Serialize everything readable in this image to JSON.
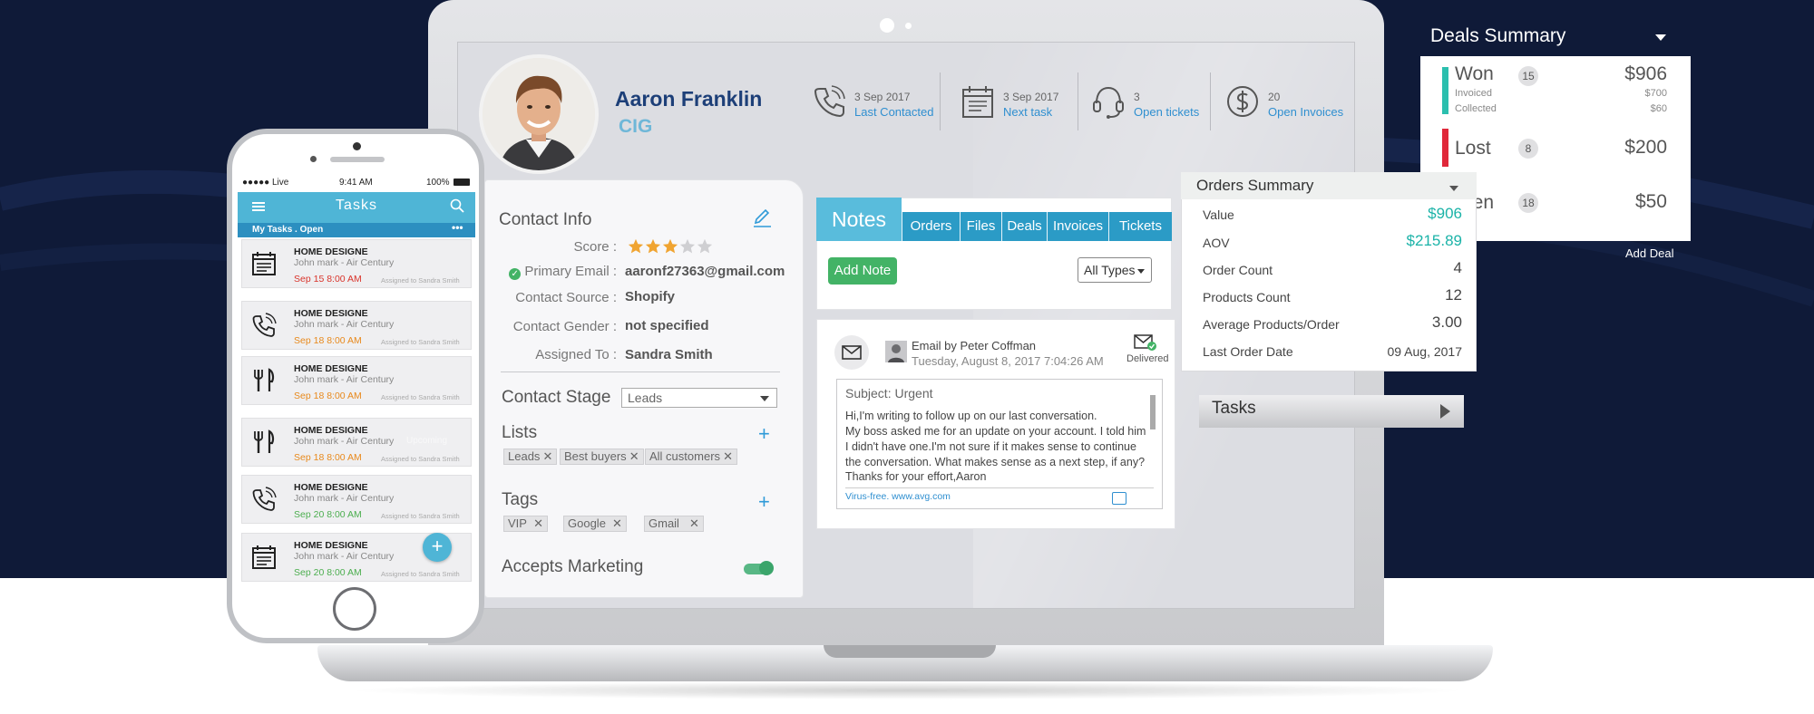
{
  "contact": {
    "name": "Aaron Franklin",
    "company": "CIG",
    "avatar_icon": "profile-photo"
  },
  "stats": [
    {
      "date": "3 Sep 2017",
      "label": "Last Contacted",
      "icon": "phone-icon"
    },
    {
      "date": "3 Sep 2017",
      "label": "Next task",
      "icon": "calendar-icon"
    },
    {
      "date": "3",
      "label": "Open tickets",
      "icon": "headset-icon"
    },
    {
      "date": "20",
      "label": "Open Invoices",
      "icon": "dollar-icon"
    }
  ],
  "contact_info": {
    "title": "Contact Info",
    "score_label": "Score :",
    "score_value": 3,
    "score_max": 5,
    "email_label": "Primary Email :",
    "email_value": "aaronf27363@gmail.com",
    "source_label": "Contact Source :",
    "source_value": "Shopify",
    "gender_label": "Contact Gender :",
    "gender_value": "not specified",
    "assigned_label": "Assigned To :",
    "assigned_value": "Sandra Smith",
    "stage_label": "Contact Stage",
    "stage_value": "Leads",
    "lists_label": "Lists",
    "lists": [
      "Leads",
      "Best buyers",
      "All customers"
    ],
    "tags_label": "Tags",
    "tags": [
      "VIP",
      "Google",
      "Gmail"
    ],
    "marketing_label": "Accepts Marketing",
    "marketing_on": true
  },
  "notes": {
    "tab_main": "Notes",
    "tabs": [
      "Orders",
      "Files",
      "Deals",
      "Invoices",
      "Tickets"
    ],
    "add_button": "Add Note",
    "filter": "All Types"
  },
  "email": {
    "from": "Email by Peter Coffman",
    "date": "Tuesday, August 8, 2017 7:04:26 AM",
    "status": "Delivered",
    "subject": "Subject: Urgent",
    "lines": [
      "Hi,I'm writing to follow up on our last conversation.",
      "My boss asked me for an update on your account. I told him",
      "I didn't have one.I'm not sure if it makes sense to continue",
      "the conversation. What makes sense as a next step, if any?",
      "Thanks for your effort,Aaron"
    ],
    "signature": "Virus-free. www.avg.com"
  },
  "deals": {
    "title": "Deals Summary",
    "items": [
      {
        "name": "Won",
        "count": "15",
        "amount": "$906",
        "color": "#2bbfae"
      },
      {
        "name": "Lost",
        "count": "8",
        "amount": "$200",
        "color": "#e0283a"
      },
      {
        "name": "pen",
        "count": "18",
        "amount": "$50",
        "color": "#e0283a"
      }
    ],
    "won_sub": [
      {
        "label": "Invoiced",
        "amount": "$700"
      },
      {
        "label": "Collected",
        "amount": "$60"
      }
    ],
    "add": "Add Deal"
  },
  "orders": {
    "title": "Orders Summary",
    "rows": [
      {
        "label": "Value",
        "value": "$906"
      },
      {
        "label": "AOV",
        "value": "$215.89"
      },
      {
        "label": "Order Count",
        "value": "4"
      },
      {
        "label": "Products Count",
        "value": "12"
      },
      {
        "label": "Average Products/Order",
        "value": "3.00"
      },
      {
        "label": "Last Order Date",
        "value": "09 Aug, 2017"
      }
    ]
  },
  "tasks_panel": {
    "title": "Tasks"
  },
  "phone": {
    "carrier": "●●●●● Live",
    "time": "9:41 AM",
    "battery": "100%",
    "header": "Tasks",
    "subheader": "My Tasks . Open",
    "overlay": "Upcoming",
    "fab": "+",
    "tasks": [
      {
        "icon": "calendar-icon",
        "title": "HOME DESIGNE",
        "sub": "John mark - Air Century",
        "date": "Sep 15 8:00 AM",
        "date_color": "#d9342b",
        "assigned": "Assigned to Sandra Smith"
      },
      {
        "icon": "phone-icon",
        "title": "HOME DESIGNE",
        "sub": "John mark - Air Century",
        "date": "Sep 18 8:00 AM",
        "date_color": "#e8891c",
        "assigned": "Assigned to Sandra Smith"
      },
      {
        "icon": "cutlery-icon",
        "title": "HOME DESIGNE",
        "sub": "John mark - Air Century",
        "date": "Sep 18 8:00 AM",
        "date_color": "#e8891c",
        "assigned": "Assigned to Sandra Smith"
      },
      {
        "icon": "cutlery-icon",
        "title": "HOME DESIGNE",
        "sub": "John mark - Air Century",
        "date": "Sep 18 8:00 AM",
        "date_color": "#e8891c",
        "assigned": "Assigned to Sandra Smith"
      },
      {
        "icon": "phone-icon",
        "title": "HOME DESIGNE",
        "sub": "John mark - Air Century",
        "date": "Sep 20 8:00 AM",
        "date_color": "#4cae4f",
        "assigned": "Assigned to Sandra Smith"
      },
      {
        "icon": "calendar-icon",
        "title": "HOME DESIGNE",
        "sub": "John mark - Air Century",
        "date": "Sep 20 8:00 AM",
        "date_color": "#4cae4f",
        "assigned": "Assigned to Sandra Smith"
      }
    ]
  },
  "colors": {
    "background": "#0f1a38",
    "accent": "#59bcdc",
    "tab": "#2b9bc6",
    "success": "#43b366",
    "teal": "#1bb3a8",
    "star": "#f0a431"
  }
}
